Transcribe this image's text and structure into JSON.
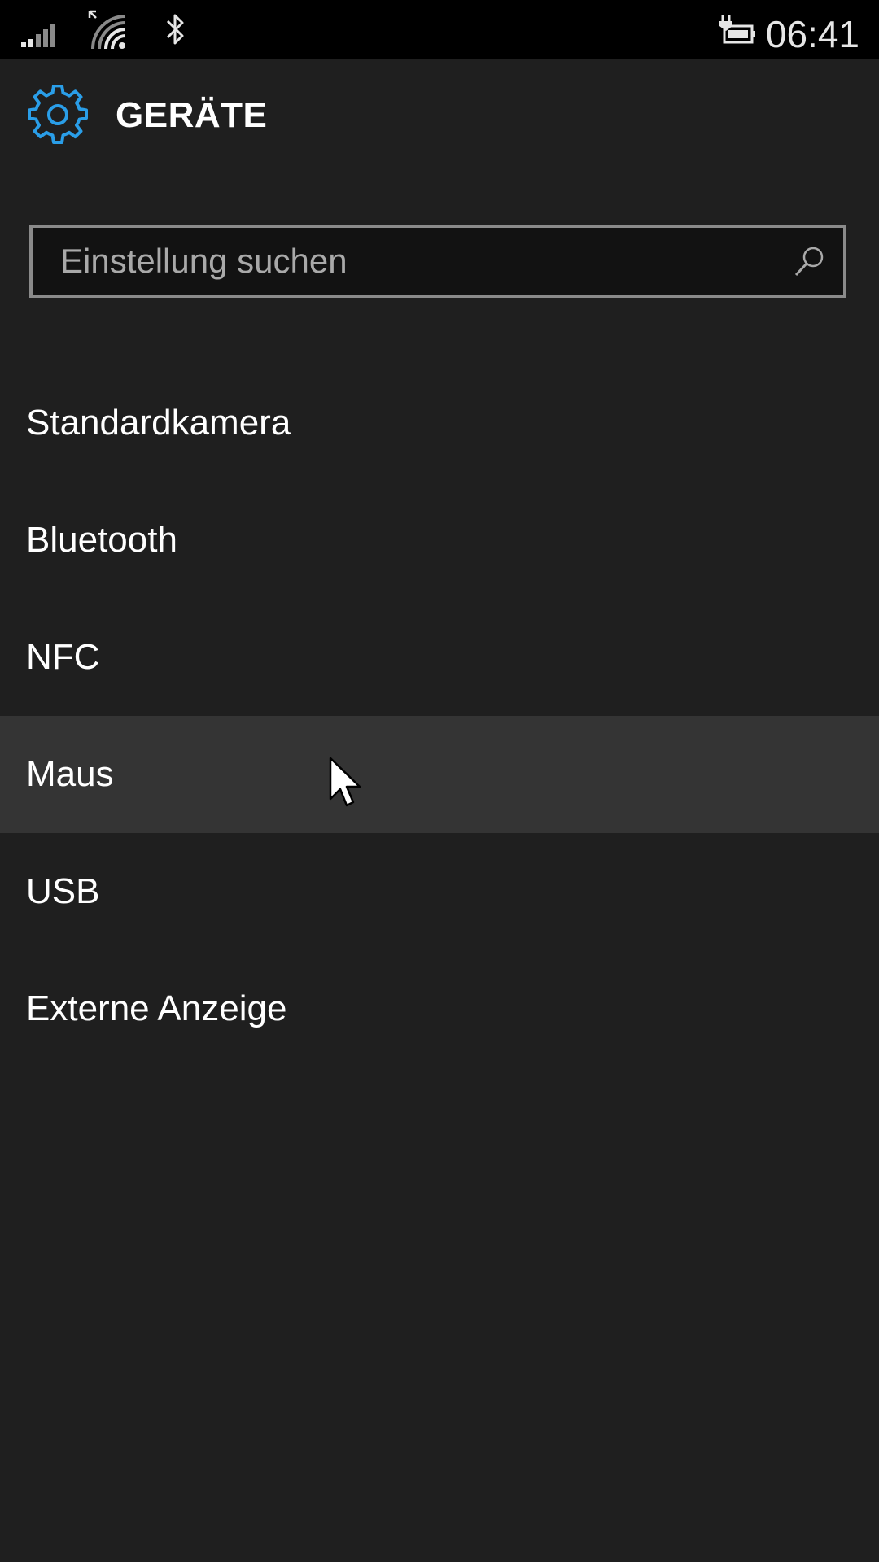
{
  "status_bar": {
    "time": "06:41",
    "icons": [
      "signal-strength-icon",
      "wifi-icon",
      "bluetooth-icon",
      "battery-charging-icon"
    ]
  },
  "header": {
    "icon": "gear-icon",
    "title": "GERÄTE",
    "accent_color": "#2a9ee8"
  },
  "search": {
    "placeholder": "Einstellung suchen",
    "value": "",
    "icon": "search-icon"
  },
  "list": {
    "items": [
      {
        "label": "Standardkamera"
      },
      {
        "label": "Bluetooth"
      },
      {
        "label": "NFC"
      },
      {
        "label": "Maus",
        "highlighted": true
      },
      {
        "label": "USB"
      },
      {
        "label": "Externe Anzeige"
      }
    ]
  },
  "colors": {
    "background": "#1f1f1f",
    "status_bar": "#000000",
    "highlight": "#343434",
    "search_border": "#8a8a8a"
  }
}
